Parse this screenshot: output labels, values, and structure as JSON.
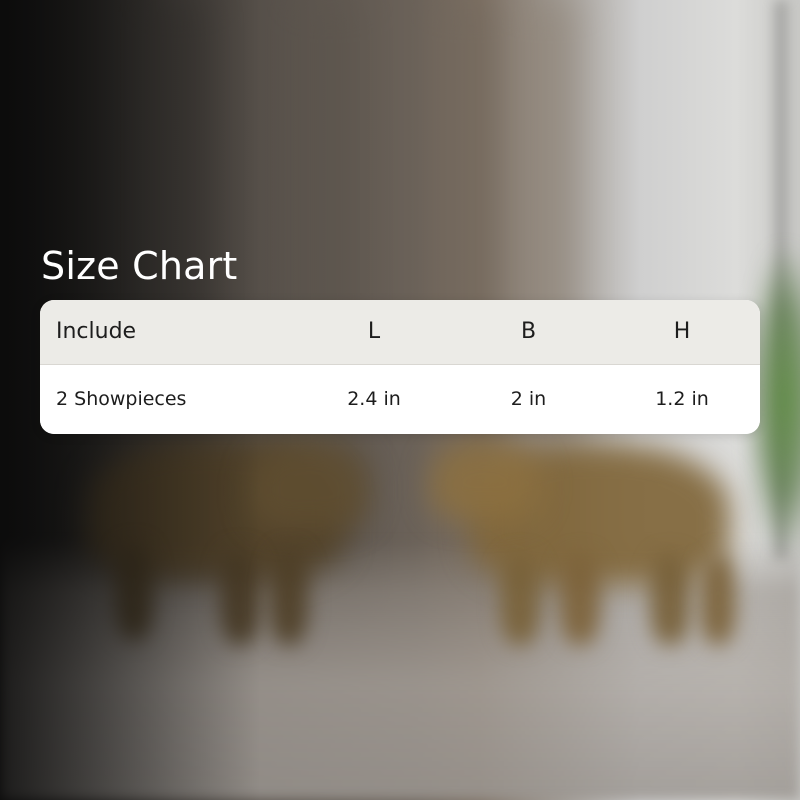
{
  "title": "Size Chart",
  "table": {
    "headers": {
      "include": "Include",
      "length": "L",
      "breadth": "B",
      "height": "H"
    },
    "rows": [
      {
        "include": "2 Showpieces",
        "length": "2.4 in",
        "breadth": "2 in",
        "height": "1.2 in"
      }
    ]
  },
  "colors": {
    "title_text": "#ffffff",
    "header_background": "#ecebe7",
    "body_background": "#ffffff",
    "text": "#1d1d1d"
  }
}
